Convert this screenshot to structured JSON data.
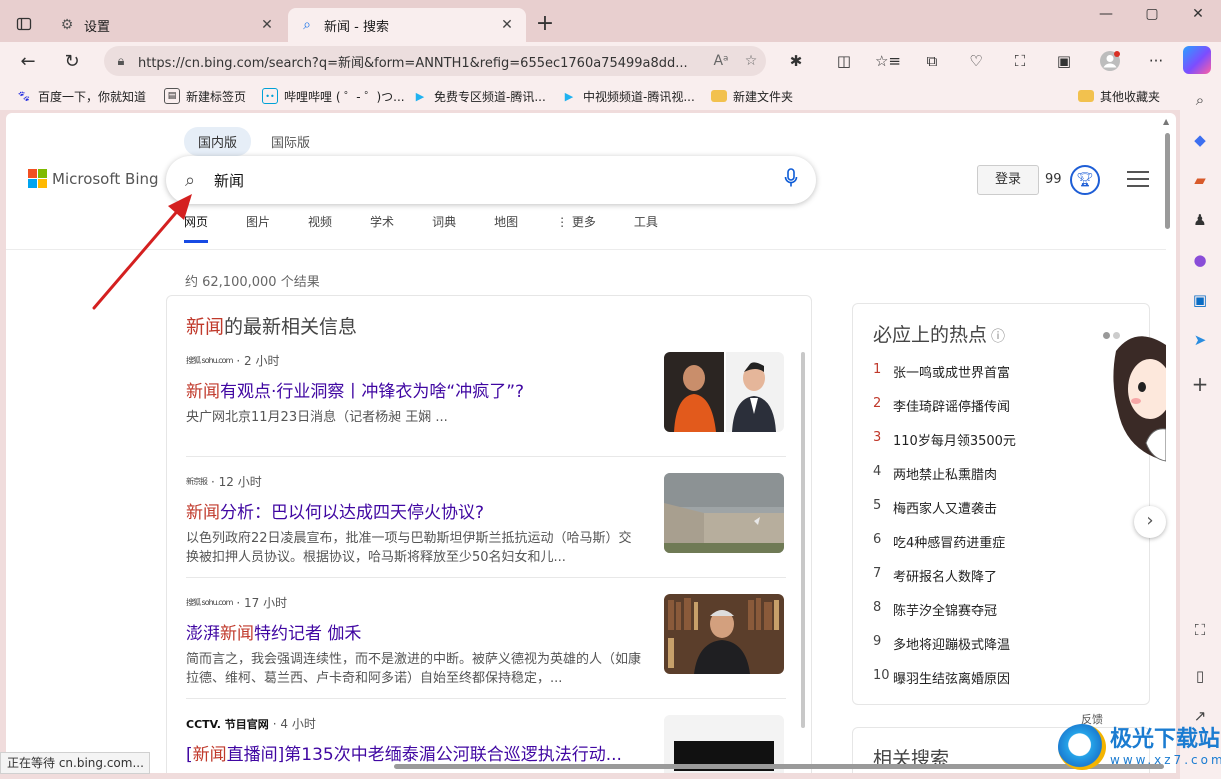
{
  "browser": {
    "tabs": [
      {
        "title": "设置",
        "icon": "gear-icon",
        "active": false
      },
      {
        "title": "新闻 - 搜索",
        "icon": "search-icon",
        "active": true
      }
    ],
    "new_tab_symbol": "+",
    "url": "https://cn.bing.com/search?q=新闻&form=ANNTH1&refig=655ec1760a75499a8dd...",
    "favorites": [
      {
        "label": "百度一下，你就知道",
        "icon": "baidu-paw-icon"
      },
      {
        "label": "新建标签页",
        "icon": "newtab-icon"
      },
      {
        "label": "哔哩哔哩 ( ゜- ゜)つ...",
        "icon": "bilibili-icon"
      },
      {
        "label": "免费专区频道-腾讯...",
        "icon": "tencent-video-icon"
      },
      {
        "label": "中视频频道-腾讯视...",
        "icon": "tencent-video-icon"
      },
      {
        "label": "新建文件夹",
        "icon": "folder-icon"
      }
    ],
    "other_favorites": "其他收藏夹",
    "status_text": "正在等待 cn.bing.com..."
  },
  "bing": {
    "scopes": [
      "国内版",
      "国际版"
    ],
    "logo_text": "Microsoft Bing",
    "query": "新闻",
    "login_label": "登录",
    "points": "99",
    "nav_tabs": [
      "网页",
      "图片",
      "视频",
      "学术",
      "词典",
      "地图",
      "⋮ 更多",
      "工具"
    ],
    "result_count": "约 62,100,000 个结果"
  },
  "news": {
    "heading_highlight": "新闻",
    "heading_rest": "的最新相关信息",
    "items": [
      {
        "source_logo": "搜狐 sohu.com",
        "time": "· 2 小时",
        "title_hl": "新闻",
        "title_rest": "有观点·行业洞察丨冲锋衣为啥“冲疯了”?",
        "snippet": "央广网北京11月23日消息（记者杨昶 王娴 ..."
      },
      {
        "source_logo": "新京报",
        "time": "· 12 小时",
        "title_hl": "新闻",
        "title_rest": "分析：巴以何以达成四天停火协议?",
        "snippet": "以色列政府22日凌晨宣布，批准一项与巴勒斯坦伊斯兰抵抗运动（哈马斯）交换被扣押人员协议。根据协议，哈马斯将释放至少50名妇女和儿..."
      },
      {
        "source_logo": "搜狐 sohu.com",
        "time": "· 17 小时",
        "title_pre": "澎湃",
        "title_hl": "新闻",
        "title_rest": "特约记者 伽禾",
        "snippet": "简而言之，我会强调连续性，而不是激进的中断。被萨义德视为英雄的人（如康拉德、维柯、葛兰西、卢卡奇和阿多诺）自始至终都保持稳定，..."
      },
      {
        "source_logo": "CCTV. 节目官网",
        "time": "· 4 小时",
        "title_pre": "[",
        "title_hl": "新闻",
        "title_rest": "直播间]第135次中老缅泰湄公河联合巡逻执法行动..."
      }
    ]
  },
  "hot": {
    "title": "必应上的热点",
    "items": [
      {
        "rank": "1",
        "text": "张一鸣或成世界首富"
      },
      {
        "rank": "2",
        "text": "李佳琦辟谣停播传闻"
      },
      {
        "rank": "3",
        "text": "110岁每月领3500元"
      },
      {
        "rank": "4",
        "text": "两地禁止私熏腊肉"
      },
      {
        "rank": "5",
        "text": "梅西家人又遭袭击"
      },
      {
        "rank": "6",
        "text": "吃4种感冒药进重症"
      },
      {
        "rank": "7",
        "text": "考研报名人数降了"
      },
      {
        "rank": "8",
        "text": "陈芋汐全锦赛夺冠"
      },
      {
        "rank": "9",
        "text": "多地将迎蹦极式降温"
      },
      {
        "rank": "10",
        "text": "曝羽生结弦离婚原因"
      }
    ],
    "feedback": "反馈",
    "related_title": "相关搜索"
  },
  "watermark": {
    "main": "极光下载站",
    "sub": "www.xz7.com"
  },
  "colors": {
    "accent": "#174ae4",
    "highlight": "#c0392b",
    "title_purple": "#4007a2",
    "browser_frame": "#e8cfcf"
  }
}
